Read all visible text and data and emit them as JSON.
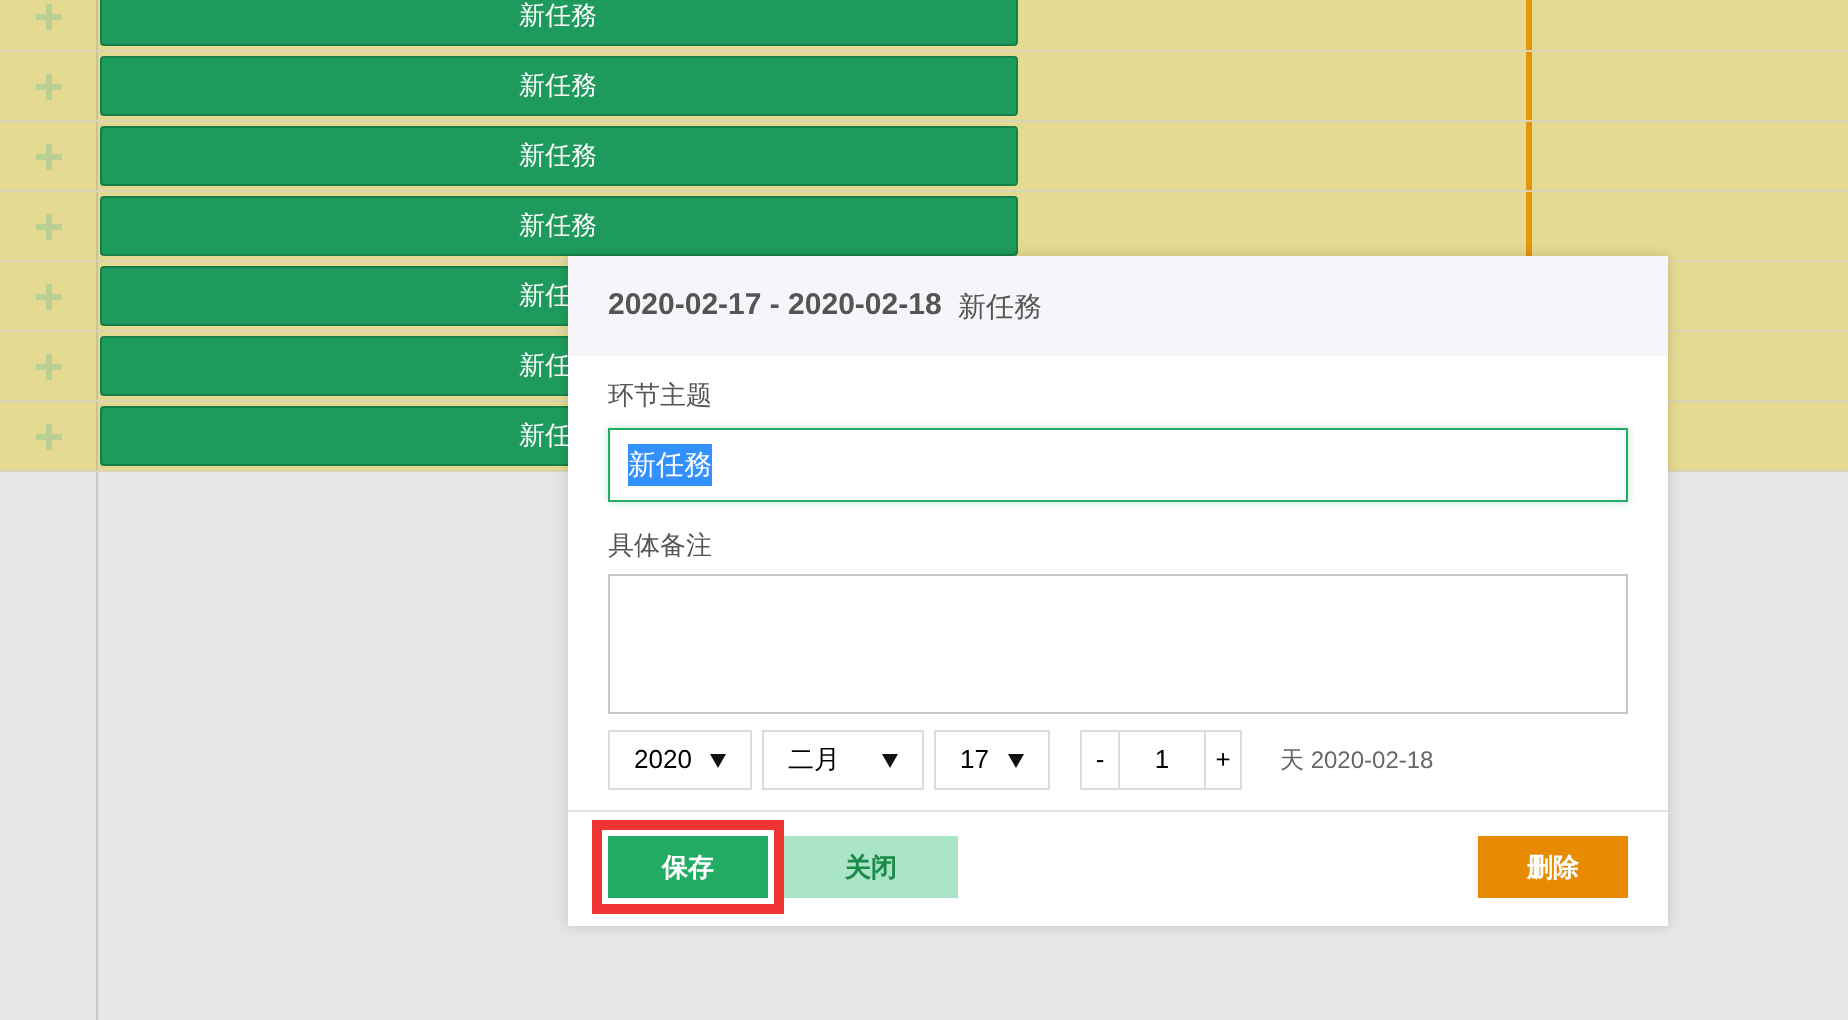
{
  "gantt": {
    "rows": [
      {
        "task": "新任務"
      },
      {
        "task": "新任務"
      },
      {
        "task": "新任務"
      },
      {
        "task": "新任務"
      },
      {
        "task": "新任"
      },
      {
        "task": "新任"
      },
      {
        "task": "新任"
      }
    ]
  },
  "dialog": {
    "date_range": "2020-02-17 - 2020-02-18",
    "title": "新任務",
    "subject_label": "环节主题",
    "subject_value": "新任務",
    "notes_label": "具体备注",
    "year": "2020",
    "month": "二月",
    "day": "17",
    "stepper": {
      "minus": "-",
      "value": "1",
      "plus": "+"
    },
    "end_text": "天 2020-02-18",
    "buttons": [
      {
        "kind": "save",
        "label": "保存",
        "highlighted": true
      },
      {
        "kind": "close",
        "label": "关闭",
        "highlighted": false
      },
      {
        "kind": "delete",
        "label": "删除",
        "highlighted": false
      }
    ]
  }
}
